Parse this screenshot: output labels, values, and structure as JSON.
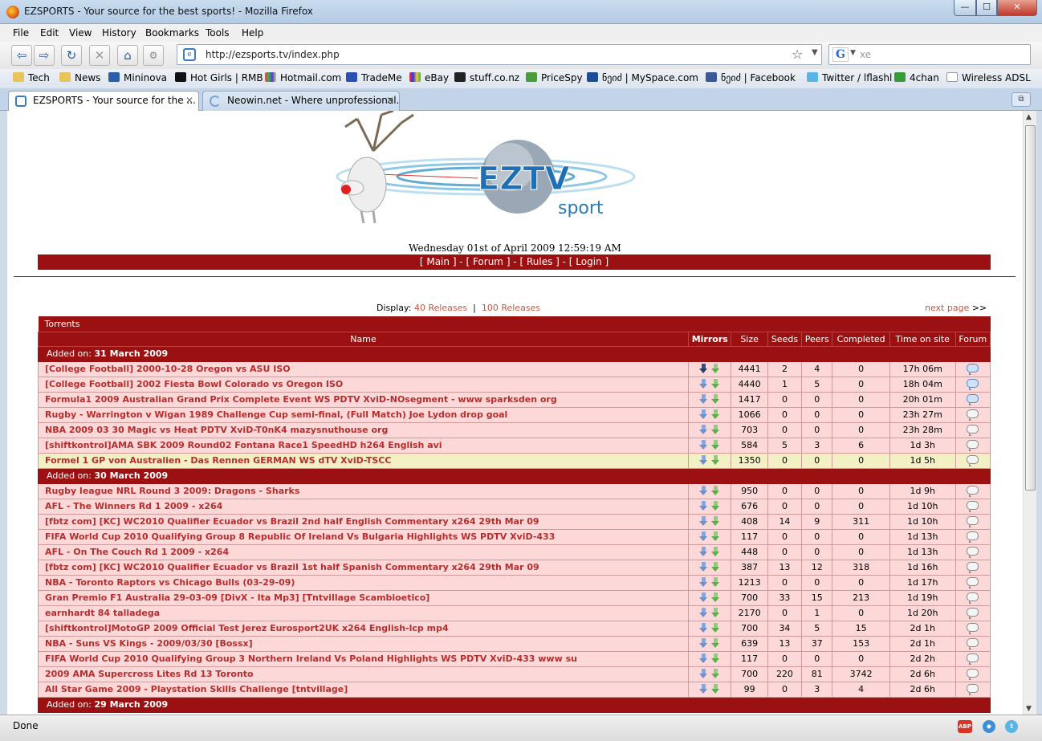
{
  "window": {
    "title": "EZSPORTS - Your source for the best sports! - Mozilla Firefox",
    "minimize": "—",
    "maximize": "☐",
    "close": "✕"
  },
  "menu": [
    "File",
    "Edit",
    "View",
    "History",
    "Bookmarks",
    "Tools",
    "Help"
  ],
  "nav": {
    "back": "⇦",
    "forward": "⇨",
    "reload": "↻",
    "stop": "✕",
    "home": "⌂",
    "url": "http://ezsports.tv/index.php",
    "search_value": "xe"
  },
  "bookmarks": [
    "Tech",
    "News",
    "Mininova",
    "Hot Girls | RMB",
    "Hotmail.com",
    "TradeMe",
    "eBay",
    "stuff.co.nz",
    "PriceSpy",
    "ნეიძ | MySpace.com",
    "ნეიძ | Facebook",
    "Twitter / lflashl",
    "4chan",
    "Wireless ADSL"
  ],
  "tabs": [
    {
      "label": "EZSPORTS - Your source for the ..."
    },
    {
      "label": "Neowin.net - Where unprofessional..."
    }
  ],
  "site": {
    "datetime": "Wednesday 01st of April 2009 12:59:19 AM",
    "nav": {
      "main": "Main",
      "forum": "Forum",
      "rules": "Rules",
      "login": "Login"
    },
    "logo_text": "EZTV",
    "logo_sub": "sport",
    "display_label": "Display:",
    "display_40": "40 Releases",
    "display_100": "100 Releases",
    "next_page": "next page",
    "next_arrows": ">>",
    "table_caption": "Torrents",
    "columns": {
      "name": "Name",
      "mirrors": "Mirrors",
      "size": "Size",
      "seeds": "Seeds",
      "peers": "Peers",
      "completed": "Completed",
      "time": "Time on site",
      "forum": "Forum"
    },
    "added_on": "Added on:",
    "groups": [
      {
        "date": "31 March 2009",
        "rows": [
          {
            "name": "[College Football] 2000-10-28 Oregon vs ASU ISO",
            "size": "4441",
            "seeds": "2",
            "peers": "4",
            "completed": "0",
            "time": "17h 06m",
            "dark": true,
            "forum_blue": true
          },
          {
            "name": "[College Football] 2002 Fiesta Bowl Colorado vs Oregon ISO",
            "size": "4440",
            "seeds": "1",
            "peers": "5",
            "completed": "0",
            "time": "18h 04m",
            "forum_blue": true
          },
          {
            "name": "Formula1 2009 Australian Grand Prix Complete Event WS PDTV XviD-NOsegment - www sparksden org",
            "size": "1417",
            "seeds": "0",
            "peers": "0",
            "completed": "0",
            "time": "20h 01m",
            "forum_blue": true
          },
          {
            "name": "Rugby - Warrington v Wigan 1989 Challenge Cup semi-final, (Full Match) Joe Lydon drop goal",
            "size": "1066",
            "seeds": "0",
            "peers": "0",
            "completed": "0",
            "time": "23h 27m"
          },
          {
            "name": "NBA 2009 03 30 Magic vs Heat PDTV XviD-T0nK4 mazysnuthouse org",
            "size": "703",
            "seeds": "0",
            "peers": "0",
            "completed": "0",
            "time": "23h 28m"
          },
          {
            "name": "[shiftkontrol]AMA SBK 2009 Round02 Fontana Race1 SpeedHD h264 English avi",
            "size": "584",
            "seeds": "5",
            "peers": "3",
            "completed": "6",
            "time": "1d 3h"
          },
          {
            "name": "Formel 1 GP von Australien - Das Rennen GERMAN WS dTV XviD-TSCC",
            "size": "1350",
            "seeds": "0",
            "peers": "0",
            "completed": "0",
            "time": "1d 5h",
            "highlight": true
          }
        ]
      },
      {
        "date": "30 March 2009",
        "rows": [
          {
            "name": "Rugby league NRL Round 3 2009: Dragons - Sharks",
            "size": "950",
            "seeds": "0",
            "peers": "0",
            "completed": "0",
            "time": "1d 9h"
          },
          {
            "name": "AFL - The Winners Rd 1 2009 - x264",
            "size": "676",
            "seeds": "0",
            "peers": "0",
            "completed": "0",
            "time": "1d 10h"
          },
          {
            "name": "[fbtz com] [KC] WC2010 Qualifier Ecuador vs Brazil 2nd half English Commentary x264 29th Mar 09",
            "size": "408",
            "seeds": "14",
            "peers": "9",
            "completed": "311",
            "time": "1d 10h"
          },
          {
            "name": "FIFA World Cup 2010 Qualifying Group 8 Republic Of Ireland Vs Bulgaria Highlights WS PDTV XviD-433",
            "size": "117",
            "seeds": "0",
            "peers": "0",
            "completed": "0",
            "time": "1d 13h"
          },
          {
            "name": "AFL - On The Couch Rd 1 2009 - x264",
            "size": "448",
            "seeds": "0",
            "peers": "0",
            "completed": "0",
            "time": "1d 13h"
          },
          {
            "name": "[fbtz com] [KC] WC2010 Qualifier Ecuador vs Brazil 1st half Spanish Commentary x264 29th Mar 09",
            "size": "387",
            "seeds": "13",
            "peers": "12",
            "completed": "318",
            "time": "1d 16h"
          },
          {
            "name": "NBA - Toronto Raptors vs Chicago Bulls (03-29-09)",
            "size": "1213",
            "seeds": "0",
            "peers": "0",
            "completed": "0",
            "time": "1d 17h"
          },
          {
            "name": "Gran Premio F1 Australia 29-03-09 [DivX - Ita Mp3] [Tntvillage Scambioetico]",
            "size": "700",
            "seeds": "33",
            "peers": "15",
            "completed": "213",
            "time": "1d 19h"
          },
          {
            "name": "earnhardt 84 talladega",
            "size": "2170",
            "seeds": "0",
            "peers": "1",
            "completed": "0",
            "time": "1d 20h"
          },
          {
            "name": "[shiftkontrol]MotoGP 2009 Official Test Jerez Eurosport2UK x264 English-lcp mp4",
            "size": "700",
            "seeds": "34",
            "peers": "5",
            "completed": "15",
            "time": "2d 1h"
          },
          {
            "name": "NBA - Suns VS Kings - 2009/03/30 [Bossx]",
            "size": "639",
            "seeds": "13",
            "peers": "37",
            "completed": "153",
            "time": "2d 1h"
          },
          {
            "name": "FIFA World Cup 2010 Qualifying Group 3 Northern Ireland Vs Poland Highlights WS PDTV XviD-433 www su",
            "size": "117",
            "seeds": "0",
            "peers": "0",
            "completed": "0",
            "time": "2d 2h"
          },
          {
            "name": "2009 AMA Supercross Lites Rd 13 Toronto",
            "size": "700",
            "seeds": "220",
            "peers": "81",
            "completed": "3742",
            "time": "2d 6h"
          },
          {
            "name": "All Star Game 2009 - Playstation Skills Challenge [tntvillage]",
            "size": "99",
            "seeds": "0",
            "peers": "3",
            "completed": "4",
            "time": "2d 6h"
          }
        ]
      },
      {
        "date": "29 March 2009",
        "rows": []
      }
    ]
  },
  "status": {
    "text": "Done",
    "abp": "ABP"
  }
}
